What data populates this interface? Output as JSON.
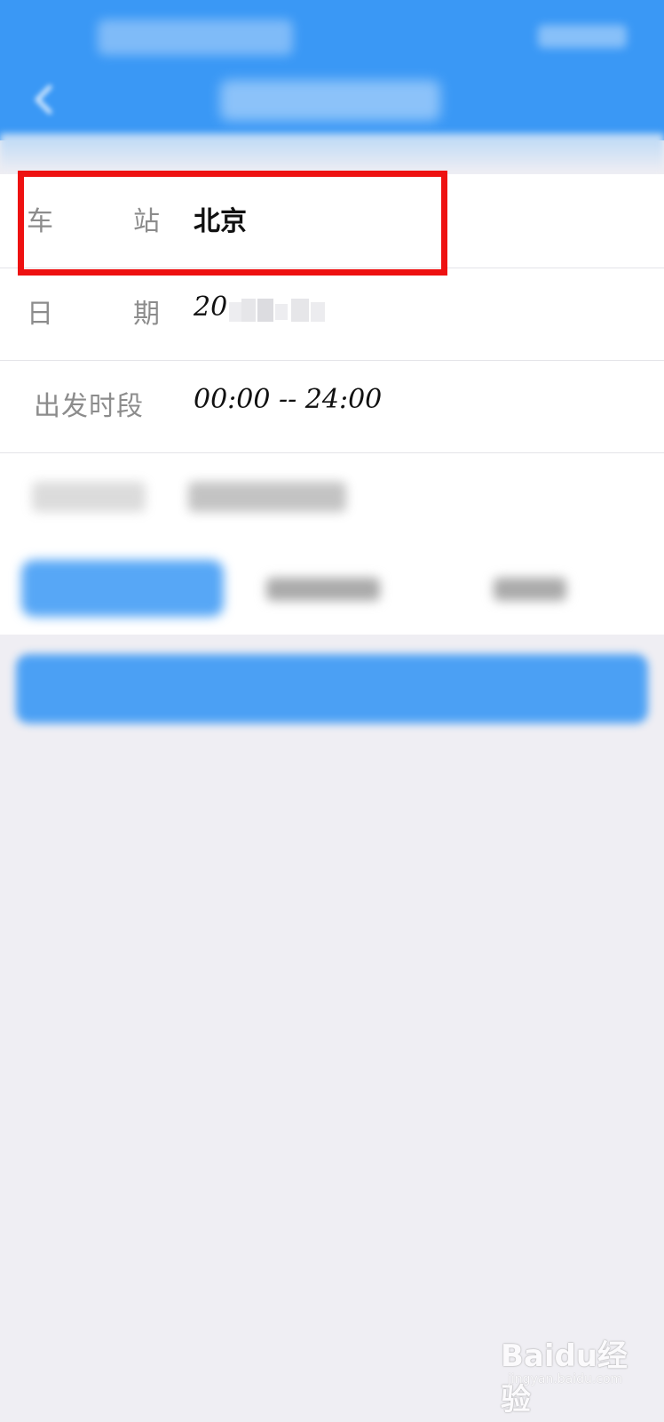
{
  "form": {
    "station": {
      "label_chars": [
        "车",
        "站"
      ],
      "value": "北京"
    },
    "date": {
      "label_chars": [
        "日",
        "期"
      ],
      "value_prefix": "20."
    },
    "departure_period": {
      "label": "出发时段",
      "value": "00:00 -- 24:00"
    }
  },
  "watermark": {
    "logo": "Baidu经验",
    "sub": "jingyan.baidu.com"
  },
  "colors": {
    "header": "#3a98f5",
    "highlight": "#ee1111",
    "background": "#efeef3"
  },
  "icons": {
    "back": "chevron-left-icon"
  }
}
